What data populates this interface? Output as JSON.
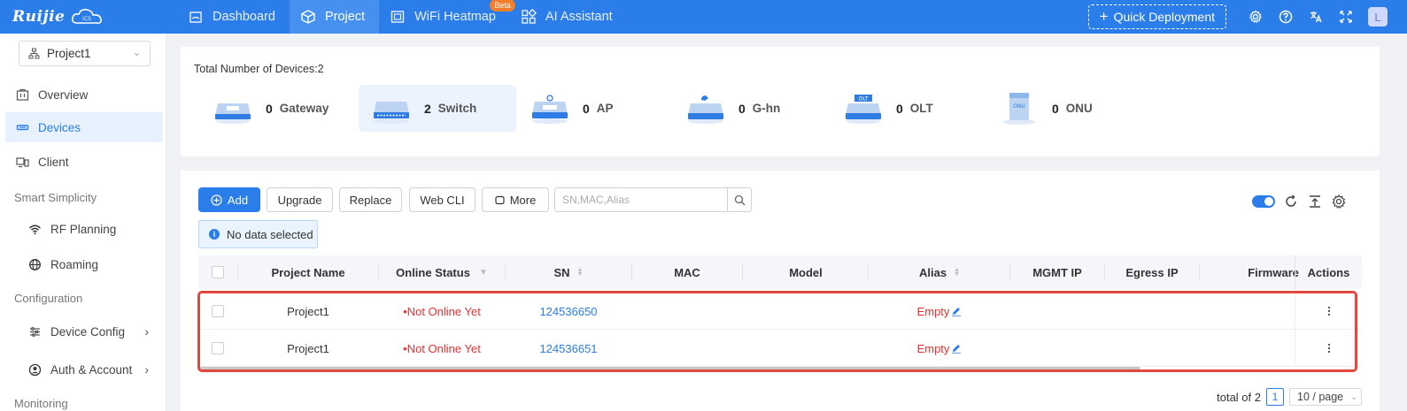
{
  "brand": {
    "name": "Ruijie",
    "cloud_label": "Cloud"
  },
  "nav": {
    "items": [
      {
        "label": "Dashboard",
        "active": false
      },
      {
        "label": "Project",
        "active": true
      },
      {
        "label": "WiFi Heatmap",
        "active": false,
        "badge": "Beta"
      },
      {
        "label": "AI Assistant",
        "active": false
      }
    ],
    "quick_deployment": "Quick Deployment",
    "avatar": "L"
  },
  "sidebar": {
    "project": "Project1",
    "items": [
      {
        "label": "Overview"
      },
      {
        "label": "Devices"
      },
      {
        "label": "Client"
      }
    ],
    "groups": {
      "smart": "Smart Simplicity",
      "config": "Configuration",
      "monitoring": "Monitoring"
    },
    "sub_items": [
      {
        "label": "RF Planning"
      },
      {
        "label": "Roaming"
      },
      {
        "label": "Device Config"
      },
      {
        "label": "Auth & Account"
      }
    ]
  },
  "summary": {
    "total": "Total Number of Devices:2",
    "types": [
      {
        "count": "0",
        "label": "Gateway"
      },
      {
        "count": "2",
        "label": "Switch"
      },
      {
        "count": "0",
        "label": "AP"
      },
      {
        "count": "0",
        "label": "G-hn"
      },
      {
        "count": "0",
        "label": "OLT"
      },
      {
        "count": "0",
        "label": "ONU"
      }
    ]
  },
  "toolbar": {
    "add": "Add",
    "upgrade": "Upgrade",
    "replace": "Replace",
    "webcli": "Web CLI",
    "more": "More",
    "search_placeholder": "SN,MAC,Alias",
    "selection": "No data selected"
  },
  "table": {
    "headers": {
      "project": "Project Name",
      "status": "Online Status",
      "sn": "SN",
      "mac": "MAC",
      "model": "Model",
      "alias": "Alias",
      "mgmt": "MGMT IP",
      "egress": "Egress IP",
      "firmware": "Firmware",
      "actions": "Actions"
    },
    "rows": [
      {
        "project": "Project1",
        "status": "Not Online Yet",
        "sn": "124536650",
        "alias": "Empty"
      },
      {
        "project": "Project1",
        "status": "Not Online Yet",
        "sn": "124536651",
        "alias": "Empty"
      }
    ]
  },
  "pagination": {
    "total": "total of 2",
    "page": "1",
    "size": "10 / page"
  },
  "colors": {
    "primary": "#2b7de9",
    "danger": "#e83030",
    "highlight": "#e3473f"
  }
}
